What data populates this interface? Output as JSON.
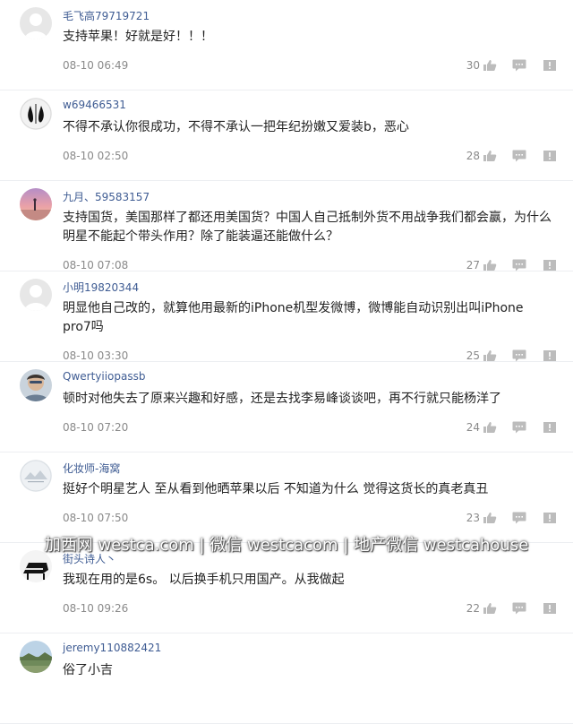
{
  "comments": [
    {
      "username": "毛飞高79719721",
      "text": "支持苹果！好就是好！！！",
      "time": "08-10 06:49",
      "likes": "30"
    },
    {
      "username": "w69466531",
      "text": "不得不承认你很成功，不得不承认一把年纪扮嫩又爱装b，恶心",
      "time": "08-10 02:50",
      "likes": "28"
    },
    {
      "username": "九月、59583157",
      "text": "支持国货，美国那样了都还用美国货？中国人自己抵制外货不用战争我们都会赢，为什么明星不能起个带头作用？除了能装逼还能做什么？",
      "time": "08-10 07:08",
      "likes": "27"
    },
    {
      "username": "小明19820344",
      "text": "明显他自己改的，就算他用最新的iPhone机型发微博，微博能自动识别出叫iPhone pro7吗",
      "time": "08-10 03:30",
      "likes": "25"
    },
    {
      "username": "Qwertyiiopassb",
      "text": "顿时对他失去了原来兴趣和好感，还是去找李易峰谈谈吧，再不行就只能杨洋了",
      "time": "08-10 07:20",
      "likes": "24"
    },
    {
      "username": "化妆师-海窝",
      "text": "挺好个明星艺人 至从看到他晒苹果以后 不知道为什么 觉得这货长的真老真丑",
      "time": "08-10 07:50",
      "likes": "23"
    },
    {
      "username": "街头诗人丶",
      "text": "我现在用的是6s。 以后换手机只用国产。从我做起",
      "time": "08-10 09:26",
      "likes": "22"
    },
    {
      "username": "jeremy110882421",
      "text": "俗了小吉",
      "time": "",
      "likes": ""
    }
  ],
  "watermark": "加西网 westca.com | 微信 westcacom | 地产微信 westcahouse",
  "icons": {
    "like": "thumbs-up-icon",
    "reply": "reply-bubble-icon",
    "more": "flag-icon"
  },
  "colors": {
    "username": "#3f5c93",
    "text": "#222222",
    "meta": "#8a8a8a",
    "icon": "#bcbcbc"
  }
}
